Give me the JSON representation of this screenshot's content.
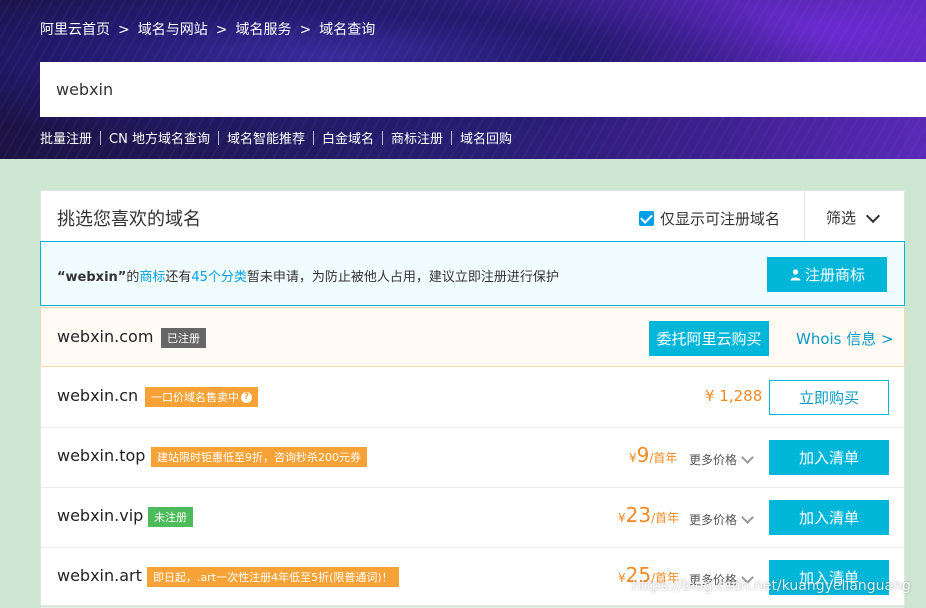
{
  "breadcrumb": [
    "阿里云首页",
    "域名与网站",
    "域名服务",
    "域名查询"
  ],
  "breadcrumb_sep": ">",
  "search": {
    "value": "webxin"
  },
  "quick_links": [
    "批量注册",
    "CN 地方域名查询",
    "域名智能推荐",
    "白金域名",
    "商标注册",
    "域名回购"
  ],
  "panel": {
    "title": "挑选您喜欢的域名",
    "only_available_label": "仅显示可注册域名",
    "filter_label": "筛选"
  },
  "trademark": {
    "quote_open": "“",
    "keyword": "webxin",
    "quote_close": "”",
    "text1": "的",
    "link1": "商标",
    "text2": "还有",
    "link2": "45个分类",
    "text3": "暂未申请，为防止被他人占用，建议立即注册进行保护",
    "button": "注册商标"
  },
  "rows": [
    {
      "domain": "webxin.com",
      "tag": "已注册",
      "action1": "委托阿里云购买",
      "action2": "Whois 信息 >"
    },
    {
      "domain": "webxin.cn",
      "tag": "一口价域名售卖中",
      "tag_icon": "?",
      "price": "¥ 1,288",
      "action": "立即购买"
    },
    {
      "domain": "webxin.top",
      "tag": "建站限时钜惠低至9折，咨询秒杀200元券",
      "currency": "¥",
      "price": "9",
      "unit": "/首年",
      "more": "更多价格",
      "action": "加入清单"
    },
    {
      "domain": "webxin.vip",
      "tag": "未注册",
      "currency": "¥",
      "price": "23",
      "unit": "/首年",
      "more": "更多价格",
      "action": "加入清单"
    },
    {
      "domain": "webxin.art",
      "tag": "即日起，.art一次性注册4年低至5折(限普通词)！",
      "currency": "¥",
      "price": "25",
      "unit": "/首年",
      "more": "更多价格",
      "action": "加入清单"
    }
  ],
  "watermark": "https://blog.csdn.net/kuangyelianguang",
  "colors": {
    "accent": "#00b6d9",
    "price": "#f08a24",
    "tag_orange": "#f6a236",
    "tag_green": "#4dbb5b",
    "tag_gray": "#666666"
  }
}
